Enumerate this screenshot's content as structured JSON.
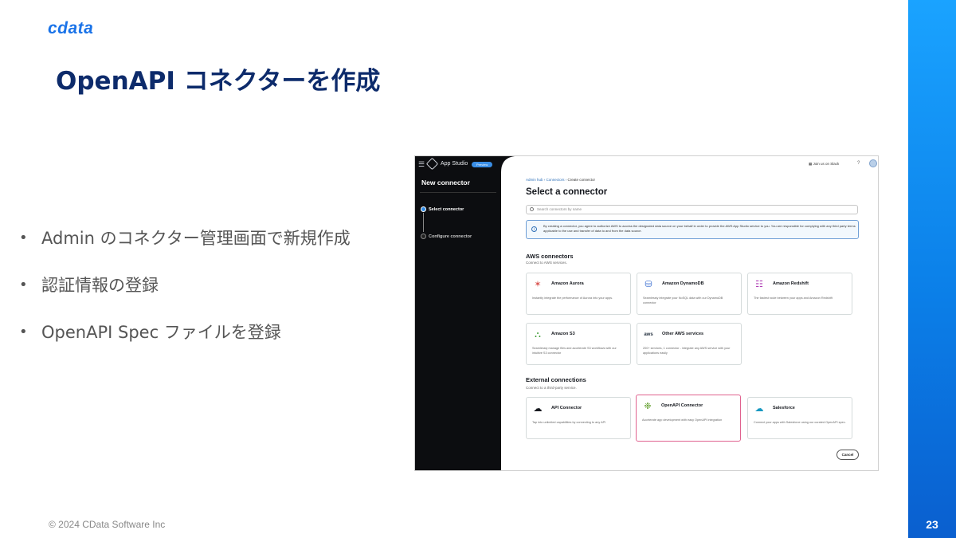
{
  "logo": "cdata",
  "title": "OpenAPI コネクターを作成",
  "bullets": [
    "Admin のコネクター管理画面で新規作成",
    "認証情報の登録",
    "OpenAPI Spec ファイルを登録"
  ],
  "footer": "© 2024 CData Software Inc",
  "page_number": "23",
  "colors": {
    "title": "#0d2b6b",
    "accent_bar": "#0b7fe8",
    "selected_card": "#e0628f"
  },
  "screenshot": {
    "app_name": "App Studio",
    "app_badge": "Preview",
    "sidebar": {
      "title": "New connector",
      "steps": [
        "Select connector",
        "Configure connector"
      ]
    },
    "header": {
      "join_slack": "Join us on Slack",
      "help": "?"
    },
    "breadcrumbs": [
      "Admin hub",
      "Connectors",
      "Create connector"
    ],
    "page_title": "Select a connector",
    "search_placeholder": "Search connectors by name",
    "info_text": "By creating a connector, you agree to authorize AWS to access the designated data source on your behalf in order to provide the AWS App Studio service to you. You are responsible for complying with any third party terms applicable to the use and transfer of data to and from the data source.",
    "aws_section": {
      "title": "AWS connectors",
      "subtitle": "Connect to AWS services."
    },
    "external_section": {
      "title": "External connections",
      "subtitle": "Connect to a third-party service."
    },
    "aws_cards": [
      {
        "name": "Amazon Aurora",
        "desc": "Instantly integrate the performance of Aurora into your apps.",
        "icon": "aurora-icon"
      },
      {
        "name": "Amazon DynamoDB",
        "desc": "Seamlessly integrate your NoSQL data with our DynamoDB connector",
        "icon": "dynamodb-icon"
      },
      {
        "name": "Amazon Redshift",
        "desc": "The fastest route between your apps and Amazon Redshift",
        "icon": "redshift-icon"
      },
      {
        "name": "Amazon S3",
        "desc": "Seamlessly manage files and accelerate S3 workflows with our intuitive S3 connector",
        "icon": "s3-icon"
      },
      {
        "name": "Other AWS services",
        "desc": "200+ services, 1 connector - integrate any AWS service with your applications easily",
        "icon": "aws-icon"
      }
    ],
    "external_cards": [
      {
        "name": "API Connector",
        "desc": "Tap into unlimited capabilities by connecting to any API",
        "icon": "cloud-icon"
      },
      {
        "name": "OpenAPI Connector",
        "desc": "Accelerate app development with easy OpenAPI integration",
        "icon": "openapi-icon"
      },
      {
        "name": "Salesforce",
        "desc": "Connect your apps with Salesforce using our curated OpenAPI spec.",
        "icon": "salesforce-icon"
      }
    ],
    "cancel_label": "Cancel"
  }
}
